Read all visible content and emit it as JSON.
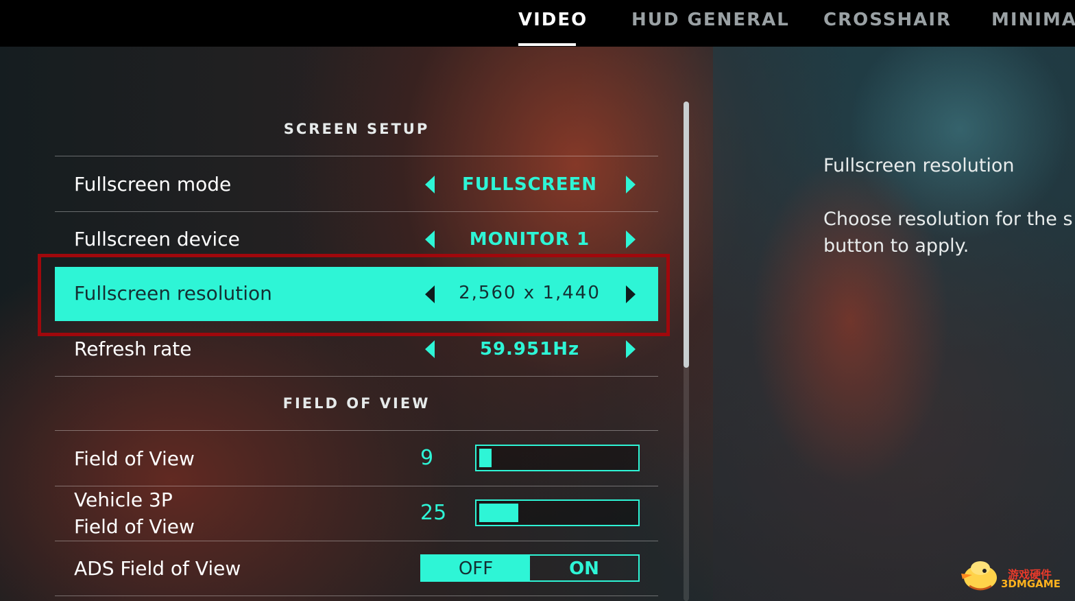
{
  "tabs": [
    {
      "label": "VIDEO",
      "active": true
    },
    {
      "label": "HUD GENERAL",
      "active": false
    },
    {
      "label": "CROSSHAIR",
      "active": false
    },
    {
      "label": "MINIMAP",
      "active": false
    }
  ],
  "sections": {
    "screen_setup": "SCREEN SETUP",
    "field_of_view": "FIELD OF VIEW"
  },
  "settings": {
    "fullscreen_mode": {
      "label": "Fullscreen mode",
      "value": "FULLSCREEN"
    },
    "fullscreen_device": {
      "label": "Fullscreen device",
      "value": "MONITOR 1"
    },
    "fullscreen_resolution": {
      "label": "Fullscreen resolution",
      "value": "2,560 x 1,440"
    },
    "refresh_rate": {
      "label": "Refresh rate",
      "value": "59.951Hz"
    },
    "fov": {
      "label": "Field of View",
      "value": "9",
      "fill_fraction": 0.08
    },
    "vehicle_fov": {
      "label_line1": "Vehicle 3P",
      "label_line2": "Field of View",
      "value": "25",
      "fill_fraction": 0.25
    },
    "ads_fov": {
      "label": "ADS Field of View",
      "off_label": "OFF",
      "on_label": "ON",
      "selected": "OFF"
    }
  },
  "description": {
    "title": "Fullscreen resolution",
    "body_line1": "Choose resolution for the s",
    "body_line2": "button to apply."
  },
  "watermark": {
    "cn": "游戏硬件",
    "en": "3DMGAME"
  },
  "colors": {
    "accent": "#2ef5d6",
    "highlight_text": "#143033",
    "red_box": "#a0080c"
  }
}
